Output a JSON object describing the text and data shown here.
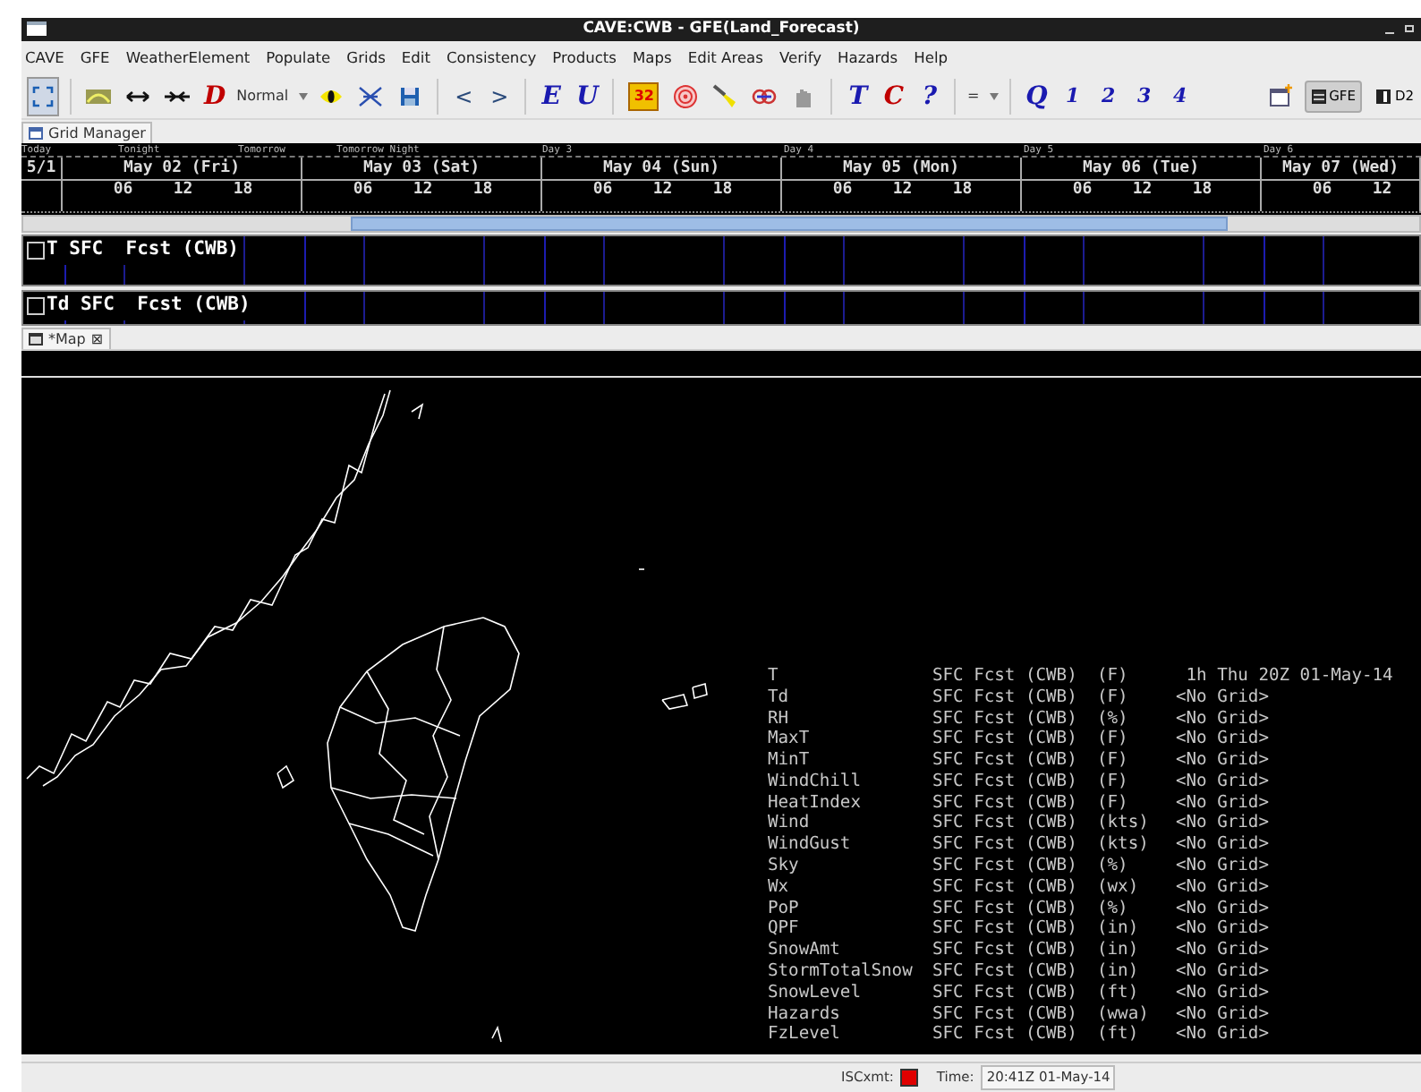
{
  "window": {
    "title": "CAVE:CWB - GFE(Land_Forecast)"
  },
  "menu": [
    "CAVE",
    "GFE",
    "WeatherElement",
    "Populate",
    "Grids",
    "Edit",
    "Consistency",
    "Products",
    "Maps",
    "Edit Areas",
    "Verify",
    "Hazards",
    "Help"
  ],
  "toolbar": {
    "d_letter": {
      "text": "D",
      "color": "#c00000"
    },
    "mode": "Normal",
    "nav": [
      "<",
      ">"
    ],
    "edit_letters": [
      {
        "text": "E",
        "color": "#1a1ab0"
      },
      {
        "text": "U",
        "color": "#1a1ab0"
      }
    ],
    "badge": "32",
    "tc_letters": [
      {
        "text": "T",
        "color": "#1a1ab0"
      },
      {
        "text": "C",
        "color": "#c00000"
      },
      {
        "text": "?",
        "color": "#1a1ab0"
      }
    ],
    "small_dropdown": "=",
    "q_letters": [
      {
        "text": "Q",
        "color": "#1a1ab0"
      },
      {
        "text": "1",
        "color": "#1a1ab0"
      },
      {
        "text": "2",
        "color": "#1a1ab0"
      },
      {
        "text": "3",
        "color": "#1a1ab0"
      },
      {
        "text": "4",
        "color": "#1a1ab0"
      }
    ],
    "perspectives": [
      {
        "label": "GFE",
        "selected": true
      },
      {
        "label": "D2",
        "selected": false
      }
    ]
  },
  "grid_manager": {
    "tab": "Grid Manager",
    "periods": [
      "Today",
      "Tonight",
      "Tomorrow",
      "Tomorrow Night",
      "Day 3",
      "Day 4",
      "Day 5",
      "Day 6"
    ],
    "days": [
      {
        "label": "5/1"
      },
      {
        "label": "May 02 (Fri)",
        "hours": [
          "06",
          "12",
          "18"
        ]
      },
      {
        "label": "May 03 (Sat)",
        "hours": [
          "06",
          "12",
          "18"
        ]
      },
      {
        "label": "May 04 (Sun)",
        "hours": [
          "06",
          "12",
          "18"
        ]
      },
      {
        "label": "May 05 (Mon)",
        "hours": [
          "06",
          "12",
          "18"
        ]
      },
      {
        "label": "May 06 (Tue)",
        "hours": [
          "06",
          "12",
          "18"
        ]
      },
      {
        "label": "May 07 (Wed)",
        "hours": [
          "06",
          "12"
        ]
      }
    ],
    "rows": [
      {
        "label": "T SFC  Fcst (CWB)",
        "checked": false
      },
      {
        "label": "Td SFC  Fcst (CWB)",
        "checked": false
      }
    ]
  },
  "map": {
    "tab": "*Map",
    "close": "⊠",
    "readout": [
      {
        "element": "T",
        "source": "SFC Fcst (CWB)",
        "units": "(F)",
        "value": " 1h Thu 20Z 01-May-14"
      },
      {
        "element": "Td",
        "source": "SFC Fcst (CWB)",
        "units": "(F)",
        "value": "<No Grid>"
      },
      {
        "element": "RH",
        "source": "SFC Fcst (CWB)",
        "units": "(%)",
        "value": "<No Grid>"
      },
      {
        "element": "MaxT",
        "source": "SFC Fcst (CWB)",
        "units": "(F)",
        "value": "<No Grid>"
      },
      {
        "element": "MinT",
        "source": "SFC Fcst (CWB)",
        "units": "(F)",
        "value": "<No Grid>"
      },
      {
        "element": "WindChill",
        "source": "SFC Fcst (CWB)",
        "units": "(F)",
        "value": "<No Grid>"
      },
      {
        "element": "HeatIndex",
        "source": "SFC Fcst (CWB)",
        "units": "(F)",
        "value": "<No Grid>"
      },
      {
        "element": "Wind",
        "source": "SFC Fcst (CWB)",
        "units": "(kts)",
        "value": "<No Grid>"
      },
      {
        "element": "WindGust",
        "source": "SFC Fcst (CWB)",
        "units": "(kts)",
        "value": "<No Grid>"
      },
      {
        "element": "Sky",
        "source": "SFC Fcst (CWB)",
        "units": "(%)",
        "value": "<No Grid>"
      },
      {
        "element": "Wx",
        "source": "SFC Fcst (CWB)",
        "units": "(wx)",
        "value": "<No Grid>"
      },
      {
        "element": "PoP",
        "source": "SFC Fcst (CWB)",
        "units": "(%)",
        "value": "<No Grid>"
      },
      {
        "element": "QPF",
        "source": "SFC Fcst (CWB)",
        "units": "(in)",
        "value": "<No Grid>"
      },
      {
        "element": "SnowAmt",
        "source": "SFC Fcst (CWB)",
        "units": "(in)",
        "value": "<No Grid>"
      },
      {
        "element": "StormTotalSnow",
        "source": "SFC Fcst (CWB)",
        "units": "(in)",
        "value": "<No Grid>"
      },
      {
        "element": "SnowLevel",
        "source": "SFC Fcst (CWB)",
        "units": "(ft)",
        "value": "<No Grid>"
      },
      {
        "element": "Hazards",
        "source": "SFC Fcst (CWB)",
        "units": "(wwa)",
        "value": "<No Grid>"
      },
      {
        "element": "FzLevel",
        "source": "SFC Fcst (CWB)",
        "units": "(ft)",
        "value": "<No Grid>"
      }
    ]
  },
  "status_bar": {
    "isc_label": "ISCxmt:",
    "isc_ok": false,
    "time_label": "Time:",
    "time_value": "20:41Z 01-May-14"
  }
}
